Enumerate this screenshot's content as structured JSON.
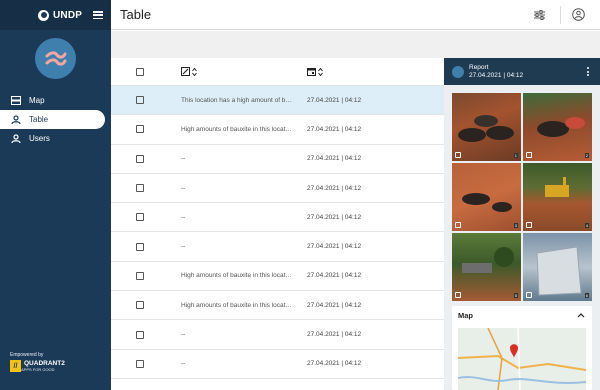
{
  "sidebar": {
    "brand": "UNDP",
    "nav": [
      {
        "label": "Map",
        "icon": "map-icon"
      },
      {
        "label": "Table",
        "icon": "person-icon"
      },
      {
        "label": "Users",
        "icon": "users-icon"
      }
    ],
    "powered_by": "Empowered by",
    "sponsor_name": "QUADRANT2",
    "sponsor_tagline": "APPS FOR GOOD",
    "sponsor_mark": "//"
  },
  "header": {
    "title": "Table"
  },
  "table": {
    "rows": [
      {
        "description": "This location has a high amount of bauxite",
        "date": "27.04.2021 | 04:12",
        "selected": true
      },
      {
        "description": "High amounts of bauxite in this location",
        "date": "27.04.2021 | 04:12"
      },
      {
        "description": "--",
        "date": "27.04.2021 | 04:12"
      },
      {
        "description": "--",
        "date": "27.04.2021 | 04:12"
      },
      {
        "description": "--",
        "date": "27.04.2021 | 04:12"
      },
      {
        "description": "--",
        "date": "27.04.2021 | 04:12"
      },
      {
        "description": "High amounts of bauxite in this location",
        "date": "27.04.2021 | 04:12"
      },
      {
        "description": "High amounts of bauxite in this location",
        "date": "27.04.2021 | 04:12"
      },
      {
        "description": "--",
        "date": "27.04.2021 | 04:12"
      },
      {
        "description": "--",
        "date": "27.04.2021 | 04:12"
      }
    ]
  },
  "panel": {
    "title": "Report",
    "subtitle": "27.04.2021 | 04:12",
    "photos": [
      {
        "num": "1"
      },
      {
        "num": "2"
      },
      {
        "num": "3"
      },
      {
        "num": "4"
      },
      {
        "num": "5"
      },
      {
        "num": "6"
      }
    ],
    "map_title": "Map"
  },
  "colors": {
    "sidebar": "#1b3a57",
    "accent": "#3f7fae",
    "selected_row": "#ddeef9",
    "panel_header": "#1f3b52"
  }
}
